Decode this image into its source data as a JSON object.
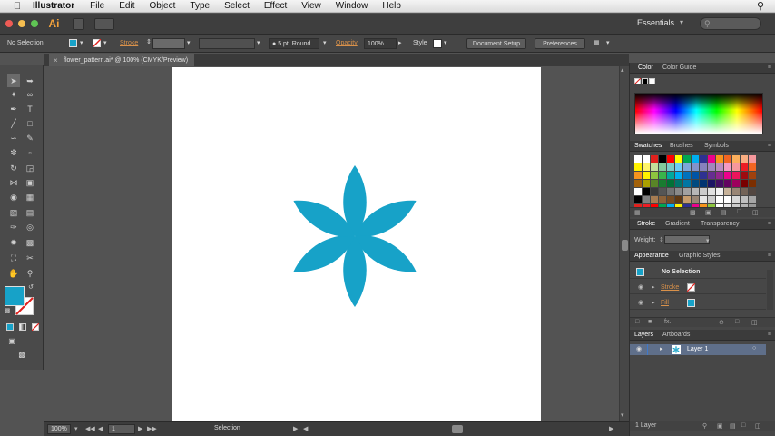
{
  "menubar": {
    "app": "Illustrator",
    "items": [
      "File",
      "Edit",
      "Object",
      "Type",
      "Select",
      "Effect",
      "View",
      "Window",
      "Help"
    ]
  },
  "appbar": {
    "logo": "Ai",
    "workspace": "Essentials"
  },
  "control": {
    "selection": "No Selection",
    "stroke_label": "Stroke",
    "stroke_weight_icon": "stepper-icon",
    "brush": "5 pt. Round",
    "opacity_label": "Opacity",
    "opacity_value": "100%",
    "style_label": "Style",
    "document_setup": "Document Setup",
    "preferences": "Preferences"
  },
  "document": {
    "tab": "flower_pattern.ai* @ 100% (CMYK/Preview)",
    "petal_color": "#17a2c8",
    "artboard_color": "#ffffff"
  },
  "status": {
    "zoom": "100%",
    "artboard_num": "1",
    "tool": "Selection"
  },
  "panels": {
    "color_tabs": [
      "Color",
      "Color Guide"
    ],
    "swatch_tabs": [
      "Swatches",
      "Brushes",
      "Symbols"
    ],
    "stroke_tabs": [
      "Stroke",
      "Gradient",
      "Transparency"
    ],
    "weight_label": "Weight:",
    "appearance_tabs": [
      "Appearance",
      "Graphic Styles"
    ],
    "appearance": {
      "title": "No Selection",
      "stroke": "Stroke",
      "fill": "Fill"
    },
    "layers_tabs": [
      "Layers",
      "Artboards"
    ],
    "layer_name": "Layer 1",
    "layers_count": "1 Layer"
  },
  "colors": {
    "fill": "#17a2c8",
    "accent_orange": "#d9914a"
  }
}
